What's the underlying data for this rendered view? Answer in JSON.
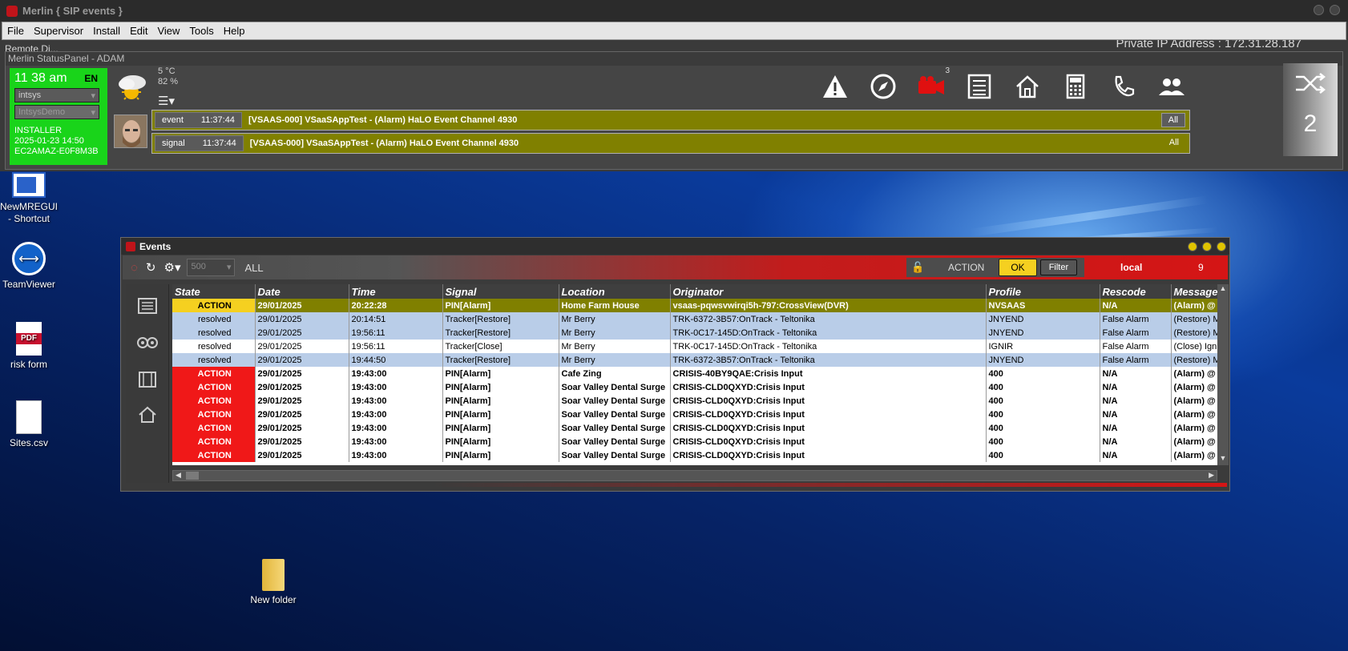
{
  "app": {
    "title": "Merlin { SIP events }",
    "menu": [
      "File",
      "Supervisor",
      "Install",
      "Edit",
      "View",
      "Tools",
      "Help"
    ],
    "ip_text": "Private IP Address : 172.31.28.187",
    "remote_text": "Remote Di..."
  },
  "status_panel": {
    "title": "Merlin StatusPanel - ADAM",
    "time": "11 38 am",
    "lang": "EN",
    "select1": "intsys",
    "select2": "IntsysDemo",
    "role": "INSTALLER",
    "datetime": "2025-01-23 14:50",
    "host": "EC2AMAZ-E0F8M3B",
    "temp": "5 °C",
    "humidity": "82 %",
    "camera_count": "3",
    "shuffle_count": "2",
    "rows": [
      {
        "type": "event",
        "time": "11:37:44",
        "message": "[VSAAS-000] VSaaSAppTest - (Alarm) HaLO Event Channel 4930",
        "button": "All"
      },
      {
        "type": "signal",
        "time": "11:37:44",
        "message": "[VSAAS-000] VSaaSAppTest - (Alarm) HaLO Event Channel 4930",
        "button": "All"
      }
    ]
  },
  "desktop": {
    "icons": [
      "NewMREGUI - Shortcut",
      "TeamViewer",
      "risk form",
      "Sites.csv",
      "New folder"
    ],
    "pdf_label": "PDF"
  },
  "events": {
    "title": "Events",
    "page_size": "500",
    "filter_all": "ALL",
    "action_label": "ACTION",
    "ok_label": "OK",
    "filter_label": "Filter",
    "local_label": "local",
    "count": "9",
    "columns": [
      "State",
      "Date",
      "Time",
      "Signal",
      "Location",
      "Originator",
      "Profile",
      "Rescode",
      "Message"
    ],
    "rows": [
      {
        "style": "action-top",
        "cells": [
          "ACTION",
          "29/01/2025",
          "20:22:28",
          "PIN[Alarm]",
          "Home Farm House",
          "vsaas-pqwsvwirqi5h-797:CrossView(DVR)",
          "NVSAAS",
          "N/A",
          "(Alarm) @"
        ]
      },
      {
        "style": "resolved",
        "cells": [
          "resolved",
          "29/01/2025",
          "20:14:51",
          "Tracker[Restore]",
          "Mr Berry",
          "TRK-6372-3B57:OnTrack - Teltonika",
          "JNYEND",
          "False Alarm",
          "(Restore) M"
        ]
      },
      {
        "style": "resolved",
        "cells": [
          "resolved",
          "29/01/2025",
          "19:56:11",
          "Tracker[Restore]",
          "Mr Berry",
          "TRK-0C17-145D:OnTrack - Teltonika",
          "JNYEND",
          "False Alarm",
          "(Restore) M"
        ]
      },
      {
        "style": "resolved white",
        "cells": [
          "resolved",
          "29/01/2025",
          "19:56:11",
          "Tracker[Close]",
          "Mr Berry",
          "TRK-0C17-145D:OnTrack - Teltonika",
          "IGNIR",
          "False Alarm",
          "(Close) Igni"
        ]
      },
      {
        "style": "resolved",
        "cells": [
          "resolved",
          "29/01/2025",
          "19:44:50",
          "Tracker[Restore]",
          "Mr Berry",
          "TRK-6372-3B57:OnTrack - Teltonika",
          "JNYEND",
          "False Alarm",
          "(Restore) M"
        ]
      },
      {
        "style": "act",
        "cells": [
          "ACTION",
          "29/01/2025",
          "19:43:00",
          "PIN[Alarm]",
          "Cafe Zing",
          "CRISIS-40BY9QAE:Crisis Input",
          "400",
          "N/A",
          "(Alarm) @"
        ]
      },
      {
        "style": "act",
        "cells": [
          "ACTION",
          "29/01/2025",
          "19:43:00",
          "PIN[Alarm]",
          "Soar Valley Dental Surge",
          "CRISIS-CLD0QXYD:Crisis Input",
          "400",
          "N/A",
          "(Alarm) @"
        ]
      },
      {
        "style": "act",
        "cells": [
          "ACTION",
          "29/01/2025",
          "19:43:00",
          "PIN[Alarm]",
          "Soar Valley Dental Surge",
          "CRISIS-CLD0QXYD:Crisis Input",
          "400",
          "N/A",
          "(Alarm) @"
        ]
      },
      {
        "style": "act",
        "cells": [
          "ACTION",
          "29/01/2025",
          "19:43:00",
          "PIN[Alarm]",
          "Soar Valley Dental Surge",
          "CRISIS-CLD0QXYD:Crisis Input",
          "400",
          "N/A",
          "(Alarm) @"
        ]
      },
      {
        "style": "act",
        "cells": [
          "ACTION",
          "29/01/2025",
          "19:43:00",
          "PIN[Alarm]",
          "Soar Valley Dental Surge",
          "CRISIS-CLD0QXYD:Crisis Input",
          "400",
          "N/A",
          "(Alarm) @"
        ]
      },
      {
        "style": "act",
        "cells": [
          "ACTION",
          "29/01/2025",
          "19:43:00",
          "PIN[Alarm]",
          "Soar Valley Dental Surge",
          "CRISIS-CLD0QXYD:Crisis Input",
          "400",
          "N/A",
          "(Alarm) @"
        ]
      },
      {
        "style": "act",
        "cells": [
          "ACTION",
          "29/01/2025",
          "19:43:00",
          "PIN[Alarm]",
          "Soar Valley Dental Surge",
          "CRISIS-CLD0QXYD:Crisis Input",
          "400",
          "N/A",
          "(Alarm) @"
        ]
      }
    ]
  }
}
